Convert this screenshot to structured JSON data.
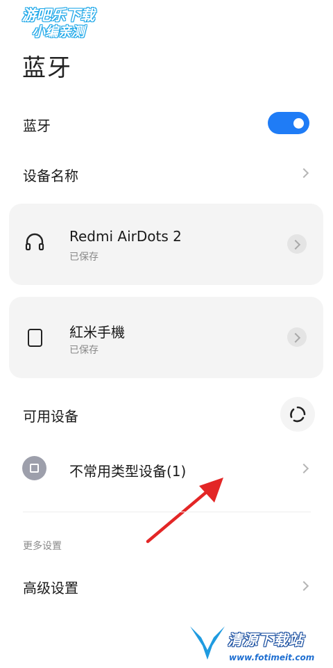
{
  "watermark_top": {
    "line1": "游吧乐下载",
    "line2": "小编亲测"
  },
  "page": {
    "title": "蓝牙"
  },
  "bluetooth": {
    "label": "蓝牙",
    "enabled": true
  },
  "device_name": {
    "label": "设备名称"
  },
  "saved_devices": [
    {
      "name": "Redmi AirDots 2",
      "status": "已保存",
      "icon": "headphones-icon"
    },
    {
      "name": "紅米手機",
      "status": "已保存",
      "icon": "phone-icon"
    }
  ],
  "available": {
    "label": "可用设备",
    "refresh_icon": "refresh-icon"
  },
  "uncommon": {
    "label": "不常用类型设备(1)"
  },
  "more": {
    "section": "更多设置",
    "advanced": "高级设置"
  },
  "watermark_bottom": {
    "brand": "清源下载站",
    "url": "www.fotimeit.com"
  },
  "colors": {
    "accent": "#1f7cf6",
    "card_bg": "#f4f4f4",
    "arrow": "#e32626"
  }
}
